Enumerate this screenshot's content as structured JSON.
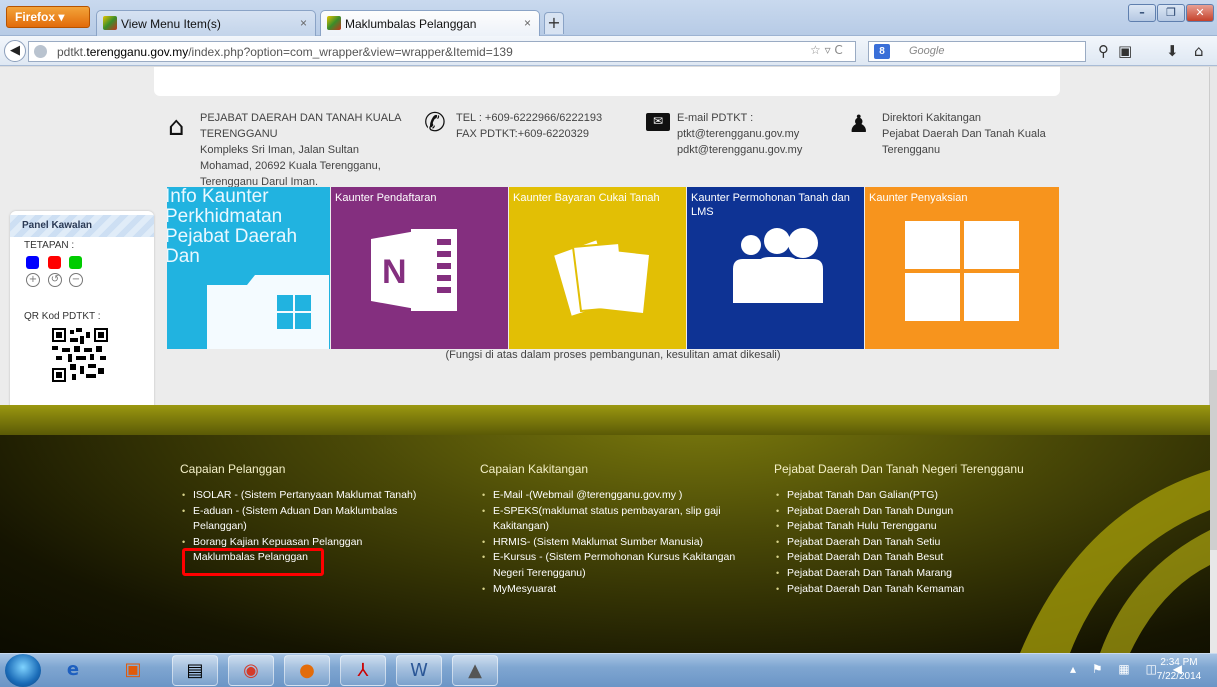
{
  "browser": {
    "app_button": "Firefox",
    "tabs": [
      {
        "label": "View Menu Item(s)"
      },
      {
        "label": "Maklumbalas Pelanggan"
      }
    ],
    "new_tab": "+",
    "url_prefix": "pdtkt.",
    "url_domain": "terengganu.gov.my",
    "url_rest": "/index.php?option=com_wrapper&view=wrapper&Itemid=139",
    "search_placeholder": "Google",
    "search_engine": "8"
  },
  "contact": {
    "office_name": "PEJABAT DAERAH DAN TANAH KUALA TERENGGANU",
    "address": "Kompleks Sri Iman, Jalan Sultan Mohamad, 20692 Kuala Terengganu, Terengganu Darul Iman.",
    "tel": "TEL : +609-6222966/6222193",
    "fax": "FAX PDTKT:+609-6220329",
    "email_label": "E-mail PDTKT :",
    "email1": "ptkt@terengganu.gov.my",
    "email2": "pdkt@terengganu.gov.my",
    "directory_title": "Direktori Kakitangan",
    "directory_sub": "Pejabat Daerah Dan Tanah Kuala Terengganu"
  },
  "panel": {
    "title": "Panel Kawalan",
    "settings_label": "TETAPAN :",
    "qr_label": "QR Kod PDTKT :",
    "colors": [
      "#0000ff",
      "#ff0000",
      "#00cc00"
    ]
  },
  "tiles": [
    {
      "label": "Info Kaunter Perkhidmatan Pejabat Daerah Dan",
      "color": "#21b3e0"
    },
    {
      "label": "Kaunter Pendaftaran",
      "color": "#842f7f"
    },
    {
      "label": "Kaunter Bayaran Cukai Tanah",
      "color": "#e2bf05"
    },
    {
      "label": "Kaunter Permohonan Tanah dan LMS",
      "color": "#0e3394"
    },
    {
      "label": "Kaunter Penyaksian",
      "color": "#f7941d"
    }
  ],
  "tiles_caption": "(Fungsi di atas dalam proses pembangunan, kesulitan amat dikesali)",
  "footer": {
    "col1": {
      "title": "Capaian Pelanggan",
      "items": [
        "ISOLAR - (Sistem Pertanyaan Maklumat Tanah)",
        "E-aduan - (Sistem Aduan Dan Maklumbalas Pelanggan)",
        "Borang Kajian Kepuasan Pelanggan",
        "Maklumbalas Pelanggan"
      ]
    },
    "col2": {
      "title": "Capaian Kakitangan",
      "items": [
        "E-Mail -(Webmail @terengganu.gov.my )",
        "E-SPEKS(maklumat status pembayaran, slip gaji Kakitangan)",
        "HRMIS- (Sistem Maklumat Sumber Manusia)",
        "E-Kursus - (Sistem Permohonan Kursus Kakitangan Negeri Terengganu)",
        "MyMesyuarat"
      ]
    },
    "col3": {
      "title": "Pejabat Daerah Dan Tanah Negeri Terengganu",
      "items": [
        "Pejabat Tanah Dan Galian(PTG)",
        "Pejabat Daerah Dan Tanah Dungun",
        "Pejabat Tanah Hulu Terengganu",
        "Pejabat Daerah Dan Tanah Setiu",
        "Pejabat Daerah Dan Tanah Besut",
        "Pejabat Daerah Dan Tanah Marang",
        "Pejabat Daerah Dan Tanah Kemaman"
      ]
    }
  },
  "taskbar": {
    "time": "2:34 PM",
    "date": "7/22/2014"
  }
}
